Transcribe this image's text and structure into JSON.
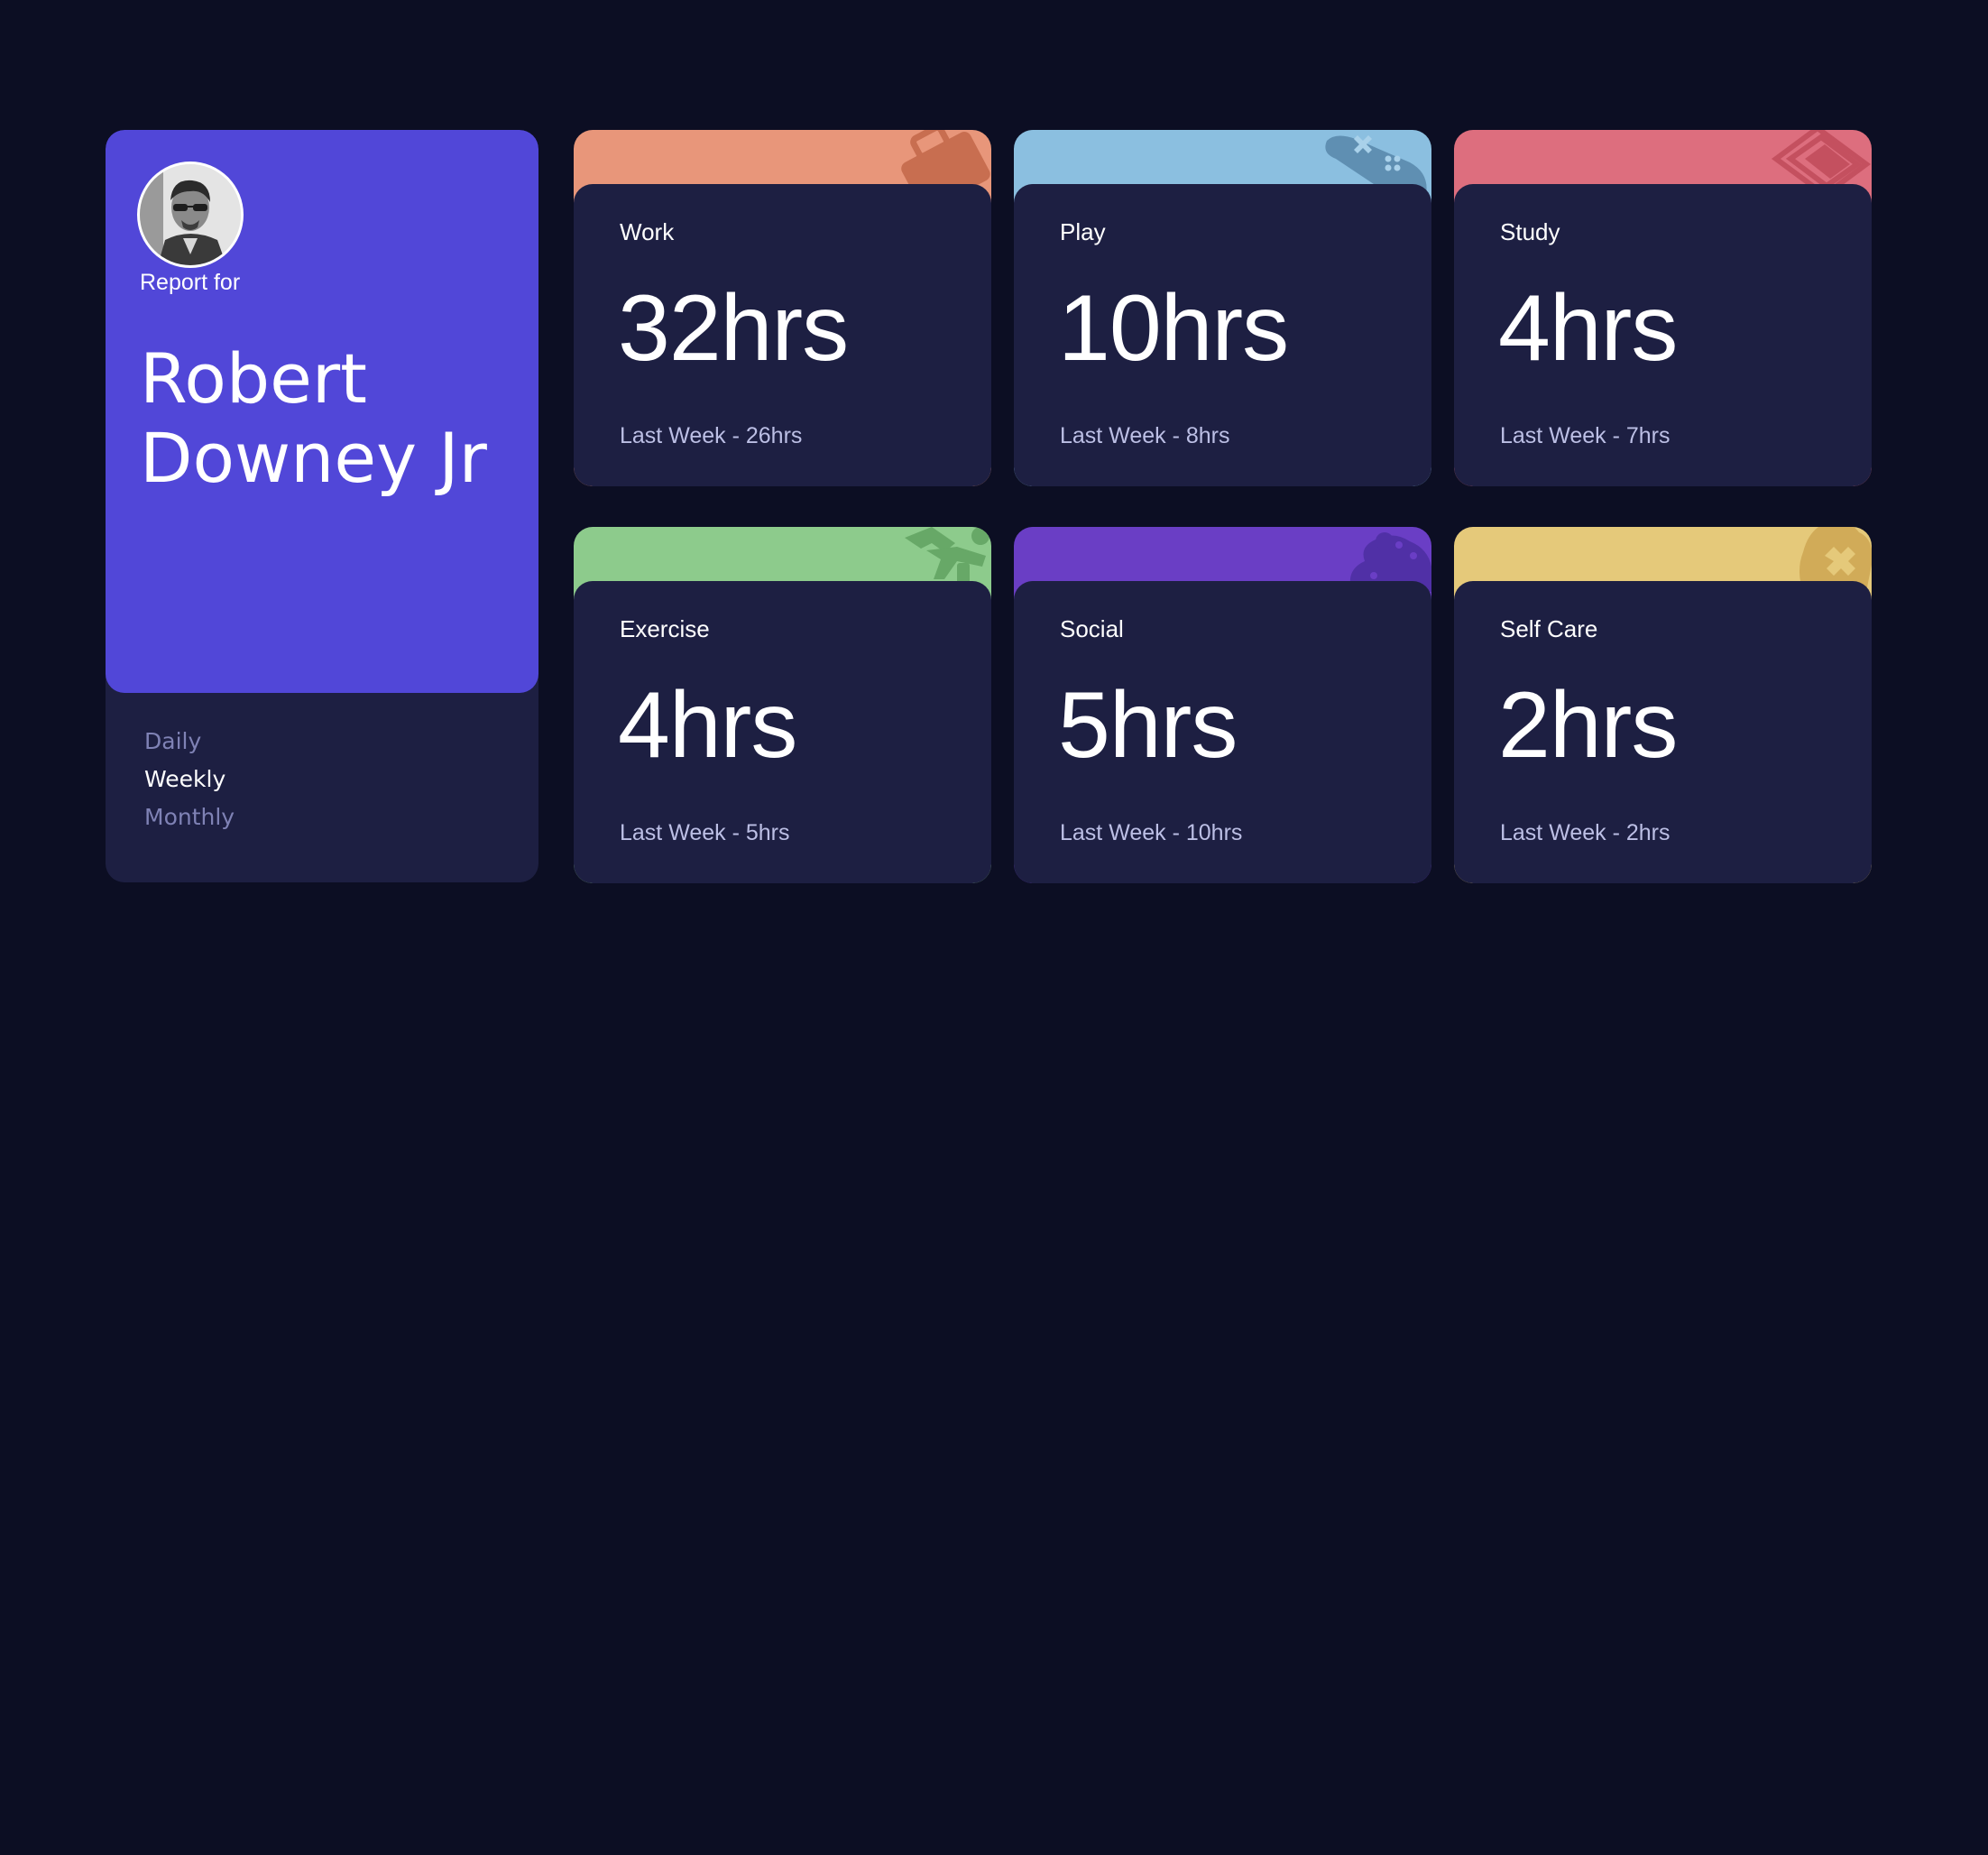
{
  "profile": {
    "report_for": "Report for",
    "name": "Robert Downey Jr",
    "periods": [
      "Daily",
      "Weekly",
      "Monthly"
    ],
    "selected_period": "Weekly"
  },
  "activities": [
    {
      "title": "Work",
      "hours": "32hrs",
      "previous": "Last Week - 26hrs",
      "color": "#e8967a",
      "icon": "briefcase-icon"
    },
    {
      "title": "Play",
      "hours": "10hrs",
      "previous": "Last Week - 8hrs",
      "color": "#8bbfe0",
      "icon": "game-controller-icon"
    },
    {
      "title": "Study",
      "hours": "4hrs",
      "previous": "Last Week - 7hrs",
      "color": "#dd6e7e",
      "icon": "book-icon"
    },
    {
      "title": "Exercise",
      "hours": "4hrs",
      "previous": "Last Week - 5hrs",
      "color": "#8dcb8c",
      "icon": "running-figure-icon"
    },
    {
      "title": "Social",
      "hours": "5hrs",
      "previous": "Last Week - 10hrs",
      "color": "#6a3ec5",
      "icon": "social-icon"
    },
    {
      "title": "Self Care",
      "hours": "2hrs",
      "previous": "Last Week - 2hrs",
      "color": "#e5c97a",
      "icon": "self-care-icon"
    }
  ]
}
